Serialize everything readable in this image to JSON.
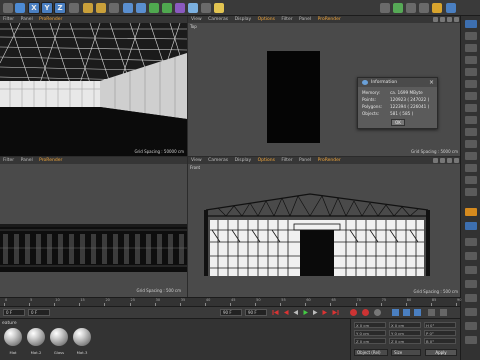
{
  "toolbar": {
    "axis_buttons": [
      "X",
      "Y",
      "Z"
    ],
    "icons": [
      "undo-icon",
      "redo-icon",
      "select-icon",
      "move-icon",
      "scale-icon",
      "rotate-icon",
      "coordinate-system-icon",
      "render-view-icon",
      "render-picture-icon",
      "render-settings-icon",
      "cube-icon",
      "spline-icon",
      "nurbs-icon",
      "array-icon",
      "deformer-icon",
      "scene-icon",
      "camera-icon",
      "light-icon",
      "snap-icon",
      "workplane-icon",
      "axis-icon"
    ]
  },
  "viewports": {
    "perspective": {
      "menu": [
        "Filter",
        "Panel",
        "ProRender"
      ],
      "grid_spacing": "Grid Spacing : 50000 cm"
    },
    "top": {
      "menu": [
        "View",
        "Cameras",
        "Display",
        "Options",
        "Filter",
        "Panel",
        "ProRender"
      ],
      "label": "Top",
      "grid_spacing": "Grid Spacing : 5000 cm"
    },
    "right": {
      "menu": [
        "Filter",
        "Panel",
        "ProRender"
      ],
      "grid_spacing": "Grid Spacing : 500 cm"
    },
    "front": {
      "menu": [
        "View",
        "Cameras",
        "Display",
        "Options",
        "Filter",
        "Panel",
        "ProRender"
      ],
      "label": "Front",
      "grid_spacing": "Grid Spacing : 500 cm"
    },
    "highlight_color": "#f2a63a"
  },
  "dialog": {
    "title": "Information",
    "rows": [
      {
        "label": "Memory:",
        "value": "ca. 1699 MByte"
      },
      {
        "label": "Points:",
        "value": "120923 ( 247022 )"
      },
      {
        "label": "Polygons:",
        "value": "122394 ( 226041 )"
      },
      {
        "label": "Objects:",
        "value": "581 ( 585 )"
      }
    ],
    "ok_label": "OK"
  },
  "timeline": {
    "ticks": [
      "0",
      "5",
      "10",
      "15",
      "20",
      "25",
      "30",
      "35",
      "40",
      "45",
      "50",
      "55",
      "60",
      "65",
      "70",
      "75",
      "80",
      "85",
      "90"
    ]
  },
  "transport": {
    "current_frame": "0 F",
    "start_frame": "0 F",
    "end_frame": "90 F",
    "end_frame2": "90 F"
  },
  "materials": {
    "tab_label": "eature",
    "items": [
      "Mat",
      "Mat.2",
      "Glass",
      "Mat.3"
    ]
  },
  "coordinates": {
    "rows": [
      {
        "a": "X  0 cm",
        "b": "X  0 cm",
        "c": "H  0°"
      },
      {
        "a": "Y  0 cm",
        "b": "Y  0 cm",
        "c": "P  0°"
      },
      {
        "a": "Z  0 cm",
        "b": "Z  0 cm",
        "c": "B  0°"
      }
    ],
    "mode_label": "Object (Rel)",
    "size_label": "Size",
    "apply_label": "Apply"
  }
}
